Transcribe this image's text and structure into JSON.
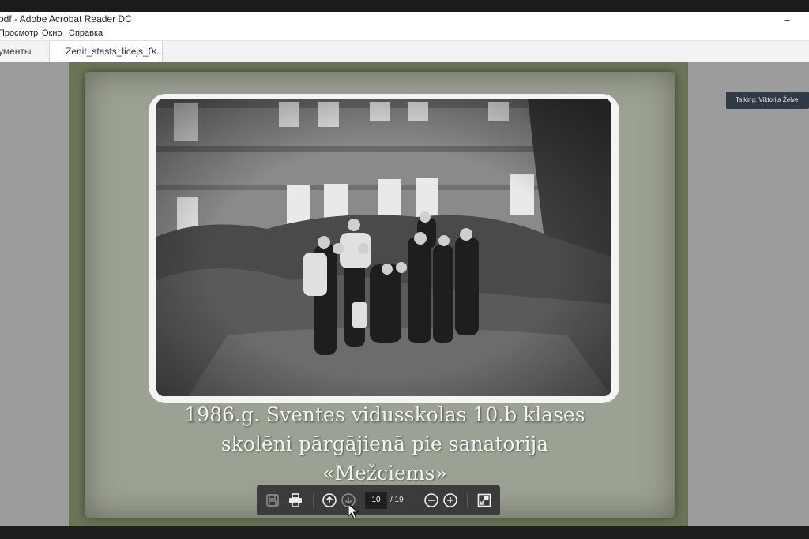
{
  "window": {
    "title": "pdf - Adobe Acrobat Reader DC",
    "minimize_glyph": "–"
  },
  "menu": {
    "items": [
      "Просмотр",
      "Окно",
      "Справка"
    ]
  },
  "tabs": {
    "documents_label": "ументы",
    "file_tab_label": "Zenit_stasts_licejs_0...",
    "close_glyph": "×"
  },
  "slide": {
    "caption_lines": [
      "1986.g.  Sventes vidusskolas 10.b klases",
      "skolēni  pārgājienā pie sanatorija",
      "«Mežciems»"
    ]
  },
  "overlay": {
    "talking_label": "Talking: Viktorija Želve"
  },
  "toolbar": {
    "current_page": "10",
    "total_pages": "/ 19",
    "icons": [
      "save-icon",
      "print-icon",
      "arrow-up-circle-icon",
      "arrow-down-circle-icon",
      "zoom-out-icon",
      "zoom-in-icon",
      "fit-page-icon"
    ]
  },
  "colors": {
    "slide_frame": "#6b7457",
    "toolbar_bg": "#3b3b3b",
    "talking_bg": "#2f3a47"
  }
}
